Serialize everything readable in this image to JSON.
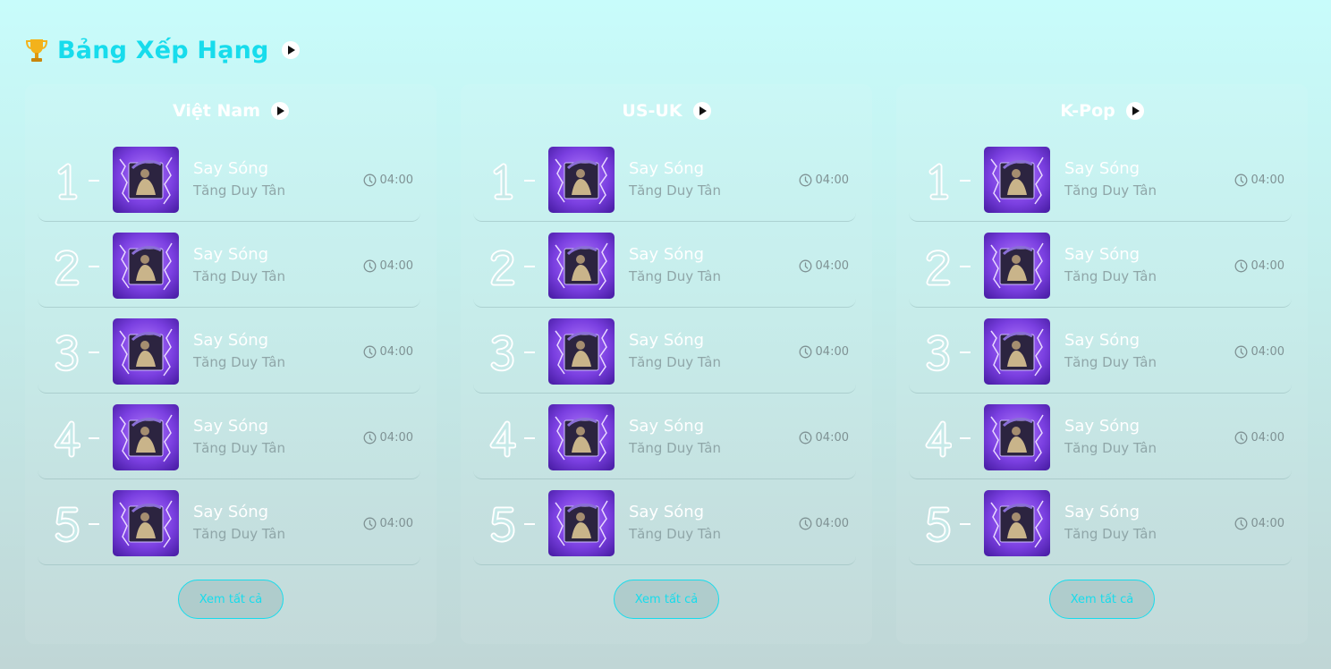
{
  "header": {
    "title": "Bảng Xếp Hạng",
    "icon": "trophy-icon"
  },
  "colors": {
    "accent": "#17dcec",
    "cover_purple": "#7a3fe0"
  },
  "charts": [
    {
      "id": "vietnam",
      "title": "Việt Nam",
      "see_all_label": "Xem tất cả",
      "songs": [
        {
          "rank": "1",
          "title": "Say Sóng",
          "artist": "Tăng Duy Tân",
          "duration": "04:00"
        },
        {
          "rank": "2",
          "title": "Say Sóng",
          "artist": "Tăng Duy Tân",
          "duration": "04:00"
        },
        {
          "rank": "3",
          "title": "Say Sóng",
          "artist": "Tăng Duy Tân",
          "duration": "04:00"
        },
        {
          "rank": "4",
          "title": "Say Sóng",
          "artist": "Tăng Duy Tân",
          "duration": "04:00"
        },
        {
          "rank": "5",
          "title": "Say Sóng",
          "artist": "Tăng Duy Tân",
          "duration": "04:00"
        }
      ]
    },
    {
      "id": "us-uk",
      "title": "US-UK",
      "see_all_label": "Xem tất cả",
      "songs": [
        {
          "rank": "1",
          "title": "Say Sóng",
          "artist": "Tăng Duy Tân",
          "duration": "04:00"
        },
        {
          "rank": "2",
          "title": "Say Sóng",
          "artist": "Tăng Duy Tân",
          "duration": "04:00"
        },
        {
          "rank": "3",
          "title": "Say Sóng",
          "artist": "Tăng Duy Tân",
          "duration": "04:00"
        },
        {
          "rank": "4",
          "title": "Say Sóng",
          "artist": "Tăng Duy Tân",
          "duration": "04:00"
        },
        {
          "rank": "5",
          "title": "Say Sóng",
          "artist": "Tăng Duy Tân",
          "duration": "04:00"
        }
      ]
    },
    {
      "id": "k-pop",
      "title": "K-Pop",
      "see_all_label": "Xem tất cả",
      "songs": [
        {
          "rank": "1",
          "title": "Say Sóng",
          "artist": "Tăng Duy Tân",
          "duration": "04:00"
        },
        {
          "rank": "2",
          "title": "Say Sóng",
          "artist": "Tăng Duy Tân",
          "duration": "04:00"
        },
        {
          "rank": "3",
          "title": "Say Sóng",
          "artist": "Tăng Duy Tân",
          "duration": "04:00"
        },
        {
          "rank": "4",
          "title": "Say Sóng",
          "artist": "Tăng Duy Tân",
          "duration": "04:00"
        },
        {
          "rank": "5",
          "title": "Say Sóng",
          "artist": "Tăng Duy Tân",
          "duration": "04:00"
        }
      ]
    }
  ]
}
